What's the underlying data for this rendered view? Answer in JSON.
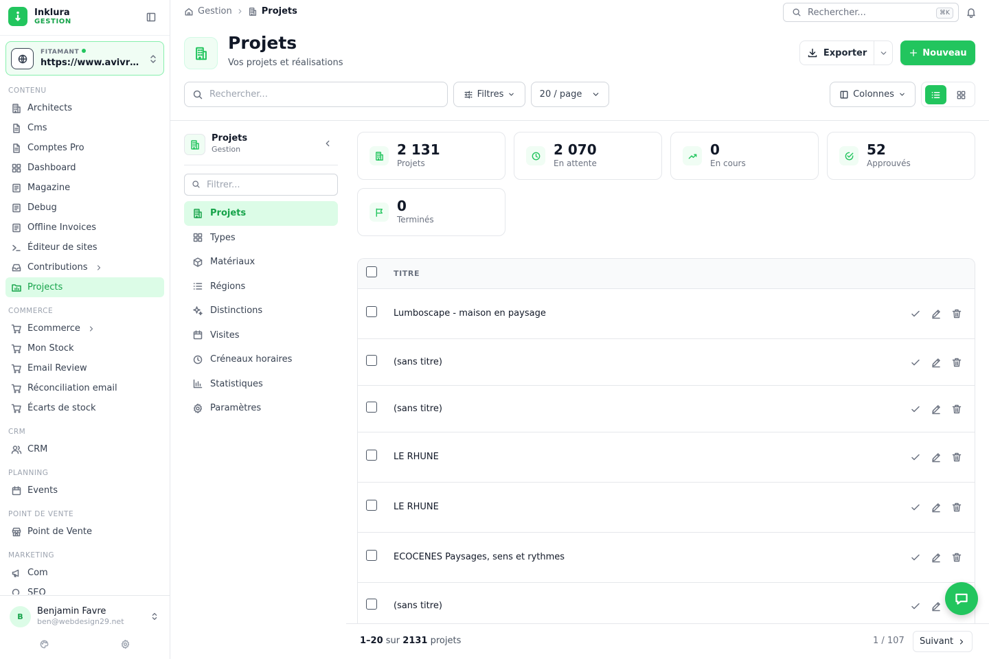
{
  "brand": {
    "name": "Inklura",
    "sub": "GESTION"
  },
  "site": {
    "status": "FITAMANT",
    "url": "https://www.avivre-paysages.fr"
  },
  "nav": {
    "contenu_label": "CONTENU",
    "contenu": [
      "Architects",
      "Cms",
      "Comptes Pro",
      "Dashboard",
      "Magazine",
      "Debug",
      "Offline Invoices",
      "Éditeur de sites",
      "Contributions",
      "Projects"
    ],
    "commerce_label": "COMMERCE",
    "commerce": [
      "Ecommerce",
      "Mon Stock",
      "Email Review",
      "Réconciliation email",
      "Écarts de stock"
    ],
    "crm_label": "CRM",
    "crm": [
      "CRM"
    ],
    "planning_label": "PLANNING",
    "planning": [
      "Events"
    ],
    "pos_label": "POINT DE VENTE",
    "pos": [
      "Point de Vente"
    ],
    "marketing_label": "MARKETING",
    "marketing": [
      "Com",
      "SEO"
    ]
  },
  "user": {
    "initial": "B",
    "name": "Benjamin Favre",
    "email": "ben@webdesign29.net"
  },
  "topbar": {
    "crumb_root": "Gestion",
    "crumb_current": "Projets",
    "search_placeholder": "Rechercher...",
    "shortcut": "⌘K"
  },
  "header": {
    "title": "Projets",
    "subtitle": "Vos projets et réalisations",
    "export_label": "Exporter",
    "new_label": "Nouveau"
  },
  "toolbar": {
    "search_placeholder": "Rechercher...",
    "filters_label": "Filtres",
    "per_page": "20 / page",
    "columns_label": "Colonnes"
  },
  "subnav": {
    "title": "Projets",
    "subtitle": "Gestion",
    "filter_placeholder": "Filtrer...",
    "items": [
      "Projets",
      "Types",
      "Matériaux",
      "Régions",
      "Distinctions",
      "Visites",
      "Créneaux horaires",
      "Statistiques",
      "Paramètres"
    ]
  },
  "stats": [
    {
      "value": "2 131",
      "label": "Projets",
      "icon": "building-icon"
    },
    {
      "value": "2 070",
      "label": "En attente",
      "icon": "clock-icon"
    },
    {
      "value": "0",
      "label": "En cours",
      "icon": "trend-icon"
    },
    {
      "value": "52",
      "label": "Approuvés",
      "icon": "check-circle-icon"
    },
    {
      "value": "0",
      "label": "Terminés",
      "icon": "flag-icon"
    }
  ],
  "table": {
    "header_title": "TITRE",
    "rows": [
      "Lumboscape - maison en paysage",
      "(sans titre)",
      "(sans titre)",
      "LE RHUNE",
      "LE RHUNE",
      "ECOCENES Paysages, sens et rythmes",
      "(sans titre)"
    ]
  },
  "pagination": {
    "range": "1–20",
    "of": "sur",
    "total": "2131",
    "unit": "projets",
    "page": "1 / 107",
    "next_label": "Suivant"
  },
  "colors": {
    "accent": "#22c55e",
    "accent_dark": "#16a34a",
    "accent_soft": "#dcfce7"
  }
}
